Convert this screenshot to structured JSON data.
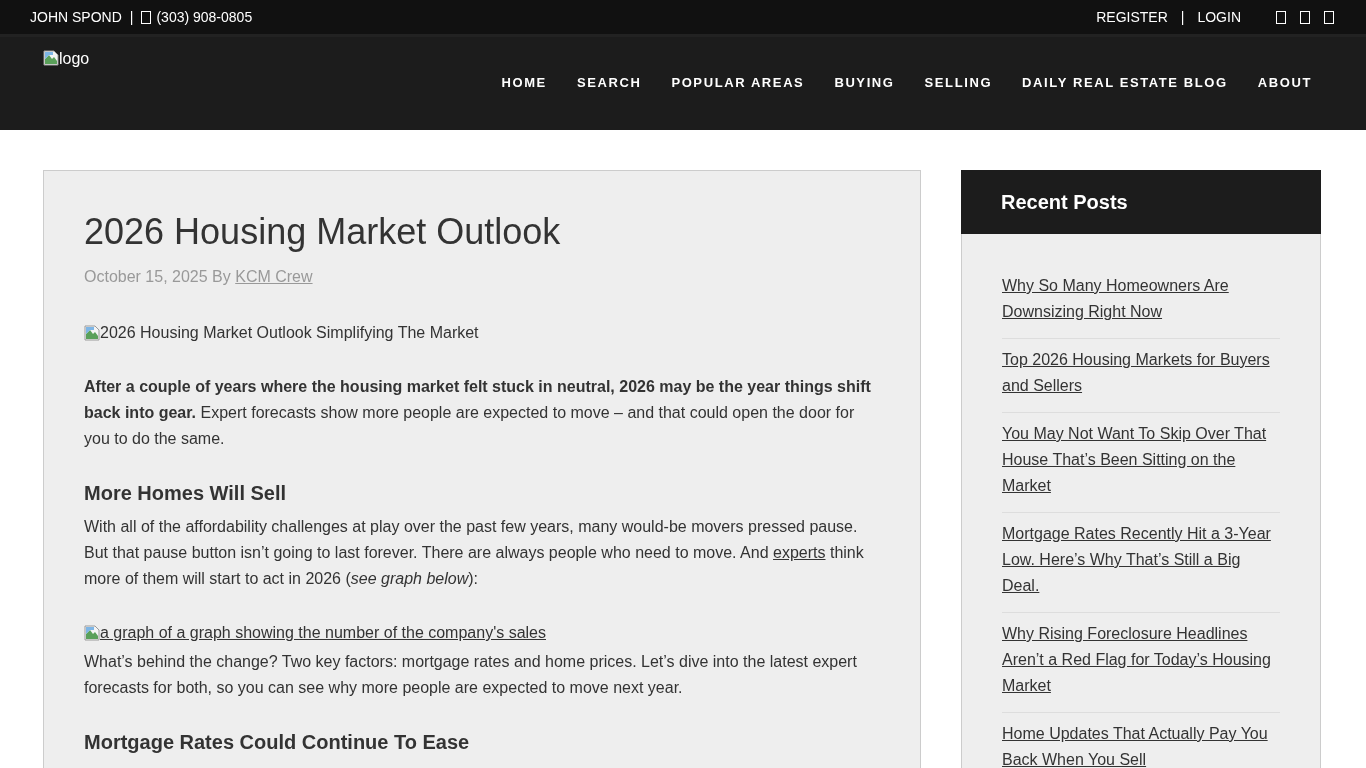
{
  "top_bar": {
    "agent_name": "JOHN SPOND",
    "separator": "|",
    "phone": "(303) 908-0805",
    "account_links": [
      "REGISTER",
      "LOGIN"
    ],
    "account_separator": "|"
  },
  "header": {
    "logo_alt": "logo",
    "nav": [
      "HOME",
      "SEARCH",
      "POPULAR AREAS",
      "BUYING",
      "SELLING",
      "DAILY REAL ESTATE BLOG",
      "ABOUT"
    ]
  },
  "article": {
    "title": "2026 Housing Market Outlook",
    "date": "October 15, 2025",
    "by": "By",
    "author": "KCM Crew",
    "blocks": [
      {
        "kind": "image",
        "alt": "2026 Housing Market Outlook Simplifying The Market"
      },
      {
        "kind": "paragraph",
        "parts": [
          {
            "kind": "text",
            "text": "**After a couple of years where the housing market felt stuck in neutral, 2026 may be the year things shift back into gear.** Expert forecasts show more people are expected to move – and that could open the door for you to do the same."
          }
        ]
      },
      {
        "kind": "heading",
        "text": "More Homes Will Sell"
      },
      {
        "kind": "paragraph",
        "parts": [
          {
            "kind": "text",
            "text": "With all of the affordability challenges at play over the past few years, many would-be movers pressed pause. But that pause button isn’t going to last forever. There are always people who need to move. And "
          },
          {
            "kind": "link",
            "text": "experts"
          },
          {
            "kind": "text",
            "text": " think more of them will start to act in 2026 (*see graph below*):"
          }
        ]
      },
      {
        "kind": "image_link",
        "alt": "a graph of a graph showing the number of the company's sales"
      },
      {
        "kind": "paragraph",
        "parts": [
          {
            "kind": "text",
            "text": "What’s behind the change? Two key factors: mortgage rates and home prices. Let’s dive into the latest expert forecasts for both, so you can see why more people are expected to move next year."
          }
        ]
      },
      {
        "kind": "heading",
        "text": "Mortgage Rates Could Continue To Ease"
      }
    ]
  },
  "sidebar": {
    "title": "Recent Posts",
    "posts": [
      "Why So Many Homeowners Are Downsizing Right Now",
      "Top 2026 Housing Markets for Buyers and Sellers",
      "You May Not Want To Skip Over That House That’s Been Sitting on the Market",
      "Mortgage Rates Recently Hit a 3-Year Low. Here’s Why That’s Still a Big Deal.",
      "Why Rising Foreclosure Headlines Aren’t a Red Flag for Today’s Housing Market",
      "Home Updates That Actually Pay You Back When You Sell"
    ]
  }
}
